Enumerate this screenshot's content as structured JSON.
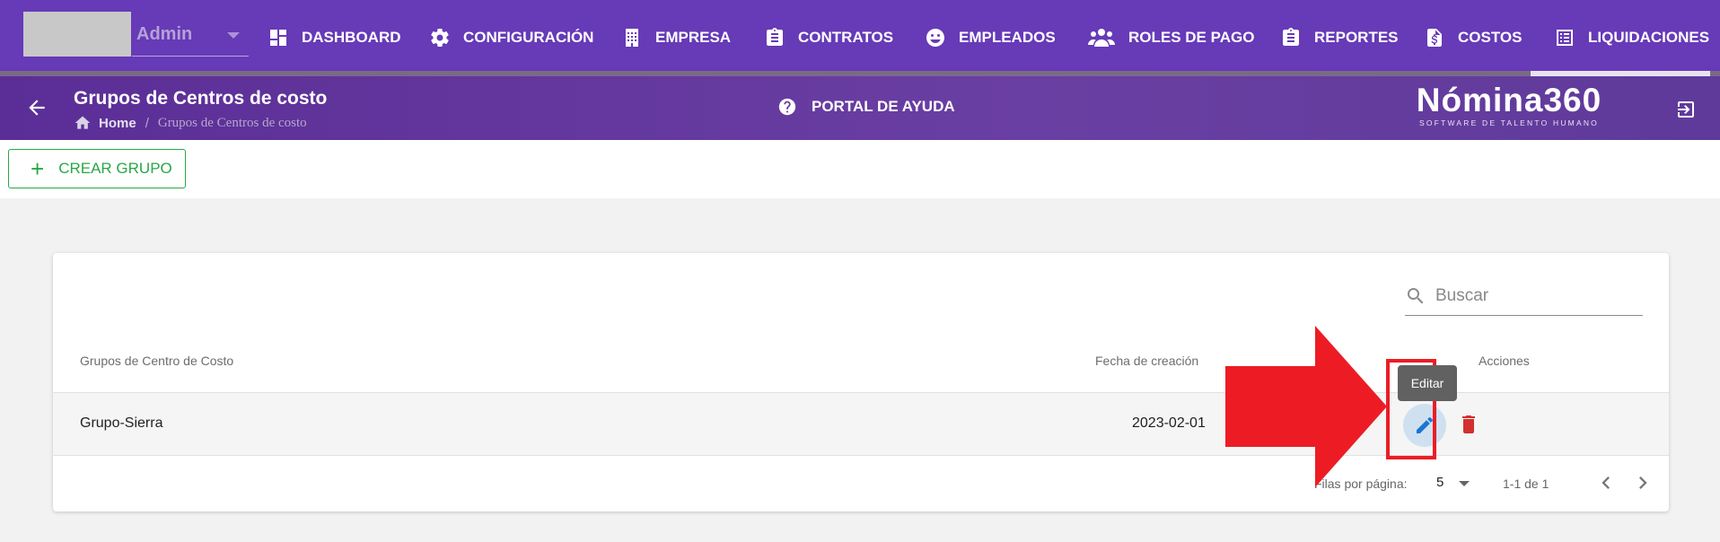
{
  "nav": {
    "company": "Admin",
    "items": [
      {
        "label": "DASHBOARD",
        "icon": "dashboard-icon"
      },
      {
        "label": "CONFIGURACIÓN",
        "icon": "gear-icon"
      },
      {
        "label": "EMPRESA",
        "icon": "building-icon"
      },
      {
        "label": "CONTRATOS",
        "icon": "clipboard-icon"
      },
      {
        "label": "EMPLEADOS",
        "icon": "face-icon"
      },
      {
        "label": "ROLES DE PAGO",
        "icon": "people-icon"
      },
      {
        "label": "REPORTES",
        "icon": "clipboard-icon"
      },
      {
        "label": "COSTOS",
        "icon": "dollar-file-icon"
      },
      {
        "label": "LIQUIDACIONES",
        "icon": "list-icon"
      }
    ]
  },
  "header": {
    "title": "Grupos de Centros de costo",
    "breadcrumb_home": "Home",
    "breadcrumb_separator": "/",
    "breadcrumb_current": "Grupos de Centros de costo",
    "help_label": "PORTAL DE AYUDA",
    "brand_name": "Nómina360",
    "brand_tagline": "SOFTWARE DE TALENTO HUMANO"
  },
  "toolbar": {
    "create_label": "CREAR GRUPO",
    "create_icon": "+"
  },
  "table": {
    "search_placeholder": "Buscar",
    "columns": {
      "name": "Grupos de Centro de Costo",
      "date": "Fecha de creación",
      "actions": "Acciones"
    },
    "rows": [
      {
        "name": "Grupo-Sierra",
        "date": "2023-02-01"
      }
    ],
    "tooltip": "Editar",
    "rows_per_page_label": "Filas por página:",
    "rows_per_page": "5",
    "range": "1-1 de 1"
  },
  "colors": {
    "nav_bg": "#673ab7",
    "accent_green": "#28a745",
    "edit_blue": "#1976d2",
    "delete_red": "#d32f2f",
    "annotation_red": "#ed1c24"
  }
}
